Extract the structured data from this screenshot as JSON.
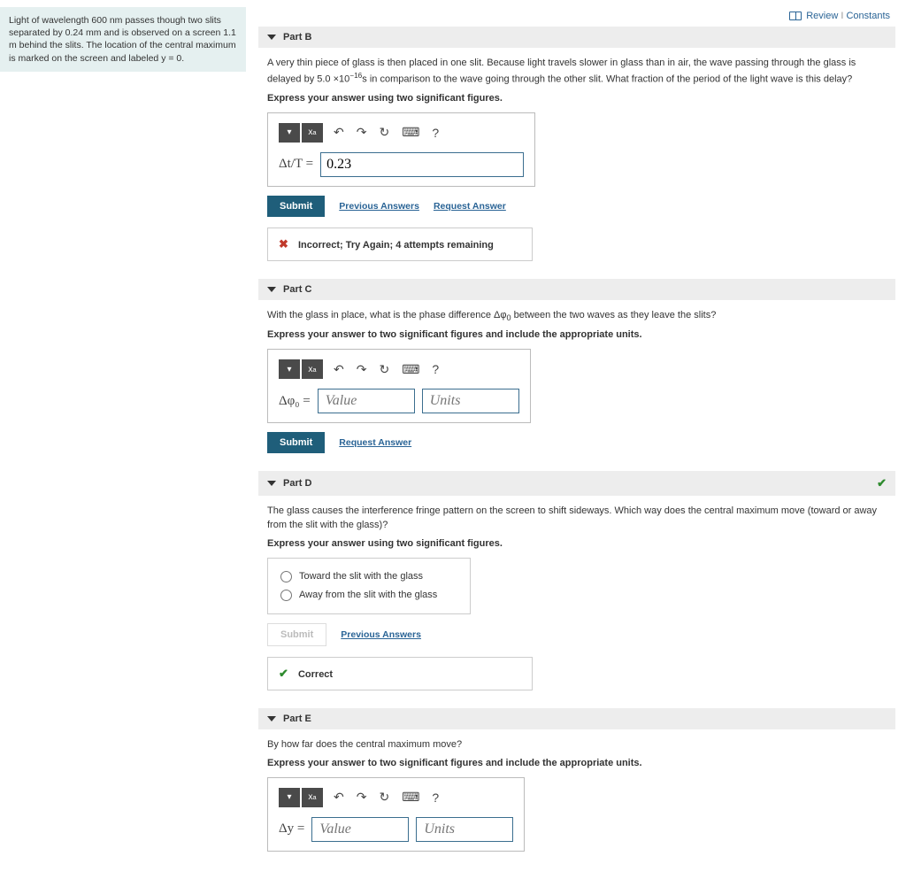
{
  "topLinks": {
    "review": "Review",
    "constants": "Constants"
  },
  "problem": "Light of wavelength 600 nm passes though two slits separated by 0.24 mm and is observed on a screen 1.1 m behind the slits. The location of the central maximum is marked on the screen and labeled y = 0.",
  "parts": {
    "B": {
      "title": "Part B",
      "question_pre": "A very thin piece of glass is then placed in one slit. Because light travels slower in glass than in air, the wave passing through the glass is delayed by 5.0 ×10",
      "question_exp": "−16",
      "question_post": "s in comparison to the wave going through the other slit. What fraction of the period of the light wave is this delay?",
      "instruction": "Express your answer using two significant figures.",
      "label": "Δt/T =",
      "value": "0.23",
      "submit": "Submit",
      "prev": "Previous Answers",
      "req": "Request Answer",
      "feedback": "Incorrect; Try Again; 4 attempts remaining"
    },
    "C": {
      "title": "Part C",
      "question_pre": "With the glass in place, what is the phase difference Δφ",
      "question_sub": "0",
      "question_post": " between the two waves as they leave the slits?",
      "instruction": "Express your answer to two significant figures and include the appropriate units.",
      "label": "Δφ₀ =",
      "valuePH": "Value",
      "unitsPH": "Units",
      "submit": "Submit",
      "req": "Request Answer"
    },
    "D": {
      "title": "Part D",
      "question": "The glass causes the interference fringe pattern on the screen to shift sideways. Which way does the central maximum move (toward or away from the slit with the glass)?",
      "instruction": "Express your answer using two significant figures.",
      "opt1": "Toward the slit with the glass",
      "opt2": "Away from the slit with the glass",
      "submit": "Submit",
      "prev": "Previous Answers",
      "feedback": "Correct"
    },
    "E": {
      "title": "Part E",
      "question": "By how far does the central maximum move?",
      "instruction": "Express your answer to two significant figures and include the appropriate units.",
      "label": "Δy =",
      "valuePH": "Value",
      "unitsPH": "Units"
    }
  },
  "toolbar": {
    "undo": "↶",
    "redo": "↷",
    "reset": "↻",
    "keyboard": "⌨",
    "help": "?"
  }
}
